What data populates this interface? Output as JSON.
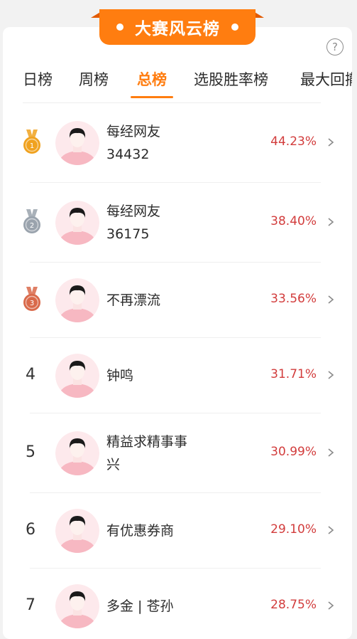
{
  "banner": {
    "title": "大赛风云榜"
  },
  "tabs": [
    {
      "label": "日榜"
    },
    {
      "label": "周榜"
    },
    {
      "label": "总榜"
    },
    {
      "label": "选股胜率榜"
    },
    {
      "label": "最大回撤"
    }
  ],
  "active_tab": "总榜",
  "colors": {
    "accent": "#ff7d10",
    "percent": "#d23c3c",
    "gold": "#f0a21f",
    "silver": "#9aa3ad",
    "bronze": "#d9694a"
  },
  "ranking": [
    {
      "rank": "1",
      "medal": "gold",
      "name_line1": "每经网友",
      "name_line2": "34432",
      "percent": "44.23%"
    },
    {
      "rank": "2",
      "medal": "silver",
      "name_line1": "每经网友",
      "name_line2": "36175",
      "percent": "38.40%"
    },
    {
      "rank": "3",
      "medal": "bronze",
      "name_line1": "不再漂流",
      "name_line2": "",
      "percent": "33.56%"
    },
    {
      "rank": "4",
      "medal": "",
      "name_line1": "钟鸣",
      "name_line2": "",
      "percent": "31.71%"
    },
    {
      "rank": "5",
      "medal": "",
      "name_line1": "精益求精事事",
      "name_line2": "兴",
      "percent": "30.99%"
    },
    {
      "rank": "6",
      "medal": "",
      "name_line1": "有优惠券商",
      "name_line2": "",
      "percent": "29.10%"
    },
    {
      "rank": "7",
      "medal": "",
      "name_line1": "多金 | 苍孙",
      "name_line2": "",
      "percent": "28.75%"
    }
  ]
}
